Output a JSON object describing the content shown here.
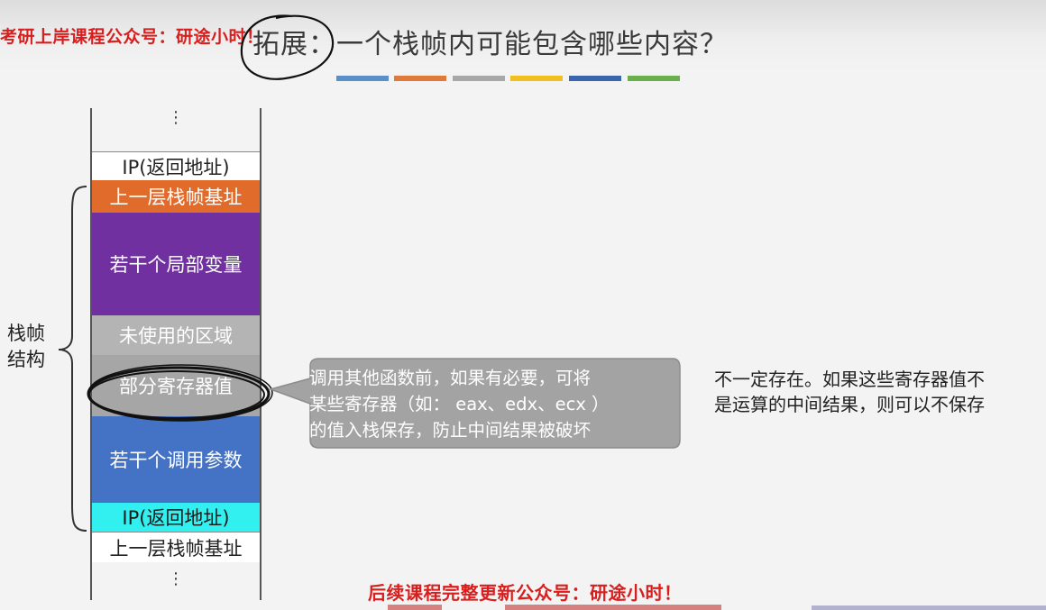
{
  "top_promo": "考研上岸课程公众号：研途小时！",
  "title": "拓展：一个栈帧内可能包含哪些内容？",
  "color_bars": [
    "#5b8fc7",
    "#e07a3a",
    "#a8a8a8",
    "#f0c020",
    "#3a66b0",
    "#6ab04c"
  ],
  "stack": {
    "top_ellipsis": "⋮",
    "bottom_ellipsis": "⋮",
    "cells": [
      {
        "label": "IP(返回地址)",
        "bg": "#ffffff",
        "fg": "#222222"
      },
      {
        "label": "上一层栈帧基址",
        "bg": "#e06b2a",
        "fg": "#ffffff"
      },
      {
        "label": "若干个局部变量",
        "bg": "#7030a0",
        "fg": "#ffffff"
      },
      {
        "label": "未使用的区域",
        "bg": "#b4b4b4",
        "fg": "#ffffff"
      },
      {
        "label": "部分寄存器值",
        "bg": "#a6a6a6",
        "fg": "#ffffff"
      },
      {
        "label": "若干个调用参数",
        "bg": "#4472c4",
        "fg": "#ffffff"
      },
      {
        "label": "IP(返回地址)",
        "bg": "#33f0f0",
        "fg": "#1a1a1a"
      },
      {
        "label": "上一层栈帧基址",
        "bg": "#ffffff",
        "fg": "#222222"
      }
    ]
  },
  "side_label_lines": [
    "栈帧",
    "结构"
  ],
  "callout_lines": [
    "调用其他函数前，如果有必要，可将",
    "某些寄存器（如： eax、edx、ecx ）",
    "的值入栈保存，防止中间结果被破坏"
  ],
  "note_lines": [
    "不一定存在。如果这些寄存器值不",
    "是运算的中间结果，则可以不保存"
  ],
  "bottom_promo": "后续课程完整更新公众号：研途小时！"
}
